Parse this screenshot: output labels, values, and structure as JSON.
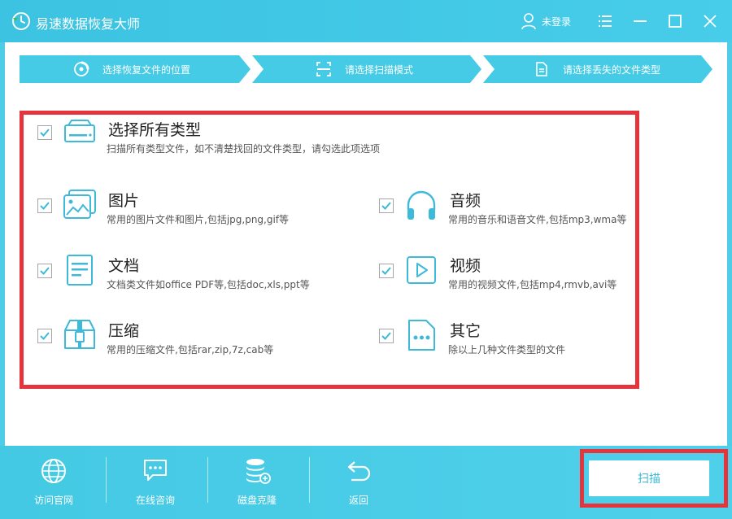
{
  "app": {
    "title": "易速数据恢复大师",
    "user_label": "未登录"
  },
  "colors": {
    "accent": "#46cbe6",
    "highlight_frame": "#e5343b",
    "text": "#222222"
  },
  "window_controls": [
    {
      "name": "menu-icon"
    },
    {
      "name": "minimize-icon"
    },
    {
      "name": "maximize-icon"
    },
    {
      "name": "close-icon"
    }
  ],
  "steps": [
    {
      "label": "选择恢复文件的位置",
      "icon": "disk-location-icon"
    },
    {
      "label": "请选择扫描模式",
      "icon": "scan-mode-icon"
    },
    {
      "label": "请选择丢失的文件类型",
      "icon": "document-icon"
    }
  ],
  "file_types": {
    "all": {
      "title": "选择所有类型",
      "desc": "扫描所有类型文件，如不清楚找回的文件类型，请勾选此项选项",
      "checked": true,
      "icon": "drive-icon"
    },
    "pictures": {
      "title": "图片",
      "desc": "常用的图片文件和图片,包括jpg,png,gif等",
      "checked": true,
      "icon": "picture-icon"
    },
    "audio": {
      "title": "音频",
      "desc": "常用的音乐和语音文件,包括mp3,wma等",
      "checked": true,
      "icon": "headphones-icon"
    },
    "documents": {
      "title": "文档",
      "desc": "文档类文件如office PDF等,包括doc,xls,ppt等",
      "checked": true,
      "icon": "document-icon"
    },
    "video": {
      "title": "视频",
      "desc": "常用的视频文件,包括mp4,rmvb,avi等",
      "checked": true,
      "icon": "video-play-icon"
    },
    "archives": {
      "title": "压缩",
      "desc": "常用的压缩文件,包括rar,zip,7z,cab等",
      "checked": true,
      "icon": "archive-icon"
    },
    "other": {
      "title": "其它",
      "desc": "除以上几种文件类型的文件",
      "checked": true,
      "icon": "more-file-icon"
    }
  },
  "bottom_nav": [
    {
      "label": "访问官网",
      "icon": "globe-icon"
    },
    {
      "label": "在线咨询",
      "icon": "chat-icon"
    },
    {
      "label": "磁盘克隆",
      "icon": "database-icon"
    },
    {
      "label": "返回",
      "icon": "back-arrow-icon"
    }
  ],
  "scan_button": {
    "label": "扫描"
  }
}
